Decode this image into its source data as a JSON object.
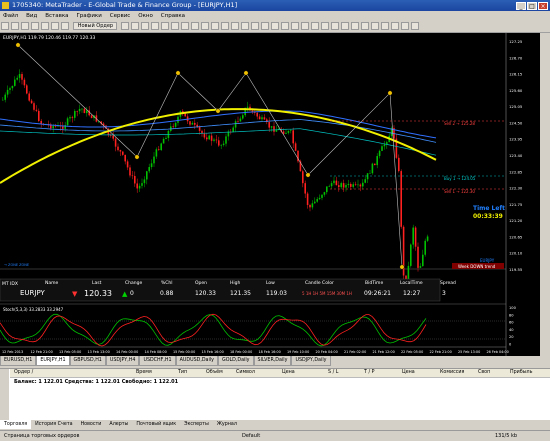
{
  "window": {
    "title": "1705340: MetaTrader - E-Global Trade & Finance Group - [EURJPY,H1]"
  },
  "menu": [
    "Файл",
    "Вид",
    "Вставка",
    "Графики",
    "Сервис",
    "Окно",
    "Справка"
  ],
  "toolbar": {
    "new_order": "Новый Ордер"
  },
  "chart": {
    "header": "EURJPY,H1  119.79 120.46 119.77 120.33",
    "price_labels": [
      "127.25",
      "126.70",
      "126.15",
      "125.60",
      "125.05",
      "124.50",
      "123.95",
      "123.40",
      "122.85",
      "122.30",
      "121.75",
      "121.20",
      "120.65",
      "120.10",
      "119.55"
    ],
    "right_labels": {
      "l1": "Sell 2 → 125.28",
      "l2": "Buy 1 → 124.05",
      "l3": "Sell 1 → 122.30"
    },
    "time_left_label": "Time Left",
    "time_left_value": "00:33:39",
    "symbol_mark": "EURJPY",
    "week_trend": "Week DOWN trend",
    "bottom_text": "→ ZONE  ZONE",
    "colors": {
      "bull": "#00c000",
      "bear": "#ff2020",
      "ma_yellow": "#f0f000",
      "ma_blue": "#3070ff",
      "stoch_main": "#00c000",
      "stoch_signal": "#ff2020"
    }
  },
  "quote": {
    "corner": "MT IDX",
    "headers": [
      "Name",
      "Last",
      "Change",
      "%Chl",
      "Open",
      "High",
      "Low",
      "Candle Color",
      "BidTime",
      "LocalTime",
      "Spread"
    ],
    "values": [
      "EURJPY",
      "120.33",
      "0",
      "0.88",
      "120.33",
      "121.35",
      "119.03",
      "",
      "09:26:21",
      "12:27",
      "3"
    ],
    "candle_colors": "5 1H 1H 5M 15M 30M 1H"
  },
  "stoch": {
    "header": "Stoch(5,3,3) 33.2833 33.2947",
    "levels": [
      "100",
      "80",
      "60",
      "40",
      "20",
      "0"
    ]
  },
  "time_axis": [
    "12 Feb 2013",
    "12 Feb 21:00",
    "13 Feb 05:00",
    "13 Feb 13:00",
    "14 Feb 00:00",
    "14 Feb 08:00",
    "15 Feb 00:00",
    "15 Feb 16:00",
    "18 Feb 00:00",
    "18 Feb 16:00",
    "19 Feb 10:00",
    "20 Feb 04:00",
    "21 Feb 02:00",
    "21 Feb 12:00",
    "22 Feb 05:00",
    "22 Feb 21:00",
    "25 Feb 13:00",
    "26 Feb 04:00"
  ],
  "symbol_tabs": [
    "EURUSD,H1",
    "EURJPY,H1",
    "GBPUSD,H1",
    "USDJPY,H4",
    "USDCHF,H1",
    "AUDUSD,Daily",
    "GOLD,Daily",
    "SILVER,Daily",
    "USDJPY,Daily"
  ],
  "terminal": {
    "columns": [
      "Ордер /",
      "Время",
      "Тип",
      "Объём",
      "Символ",
      "Цена",
      "S / L",
      "T / P",
      "Цена",
      "Комиссия",
      "Своп",
      "Прибыль"
    ],
    "balance": "Баланс: 1 122.01  Средства: 1 122.01  Свободно: 1 122.01",
    "side_label": "Терминал"
  },
  "terminal_tabs": [
    "Торговля",
    "История Счета",
    "Новости",
    "Алерты",
    "Почтовый ящик",
    "Эксперты",
    "Журнал"
  ],
  "status": {
    "help": "Страница торговых ордеров",
    "profile": "Default",
    "traffic": "131/5 kb"
  }
}
